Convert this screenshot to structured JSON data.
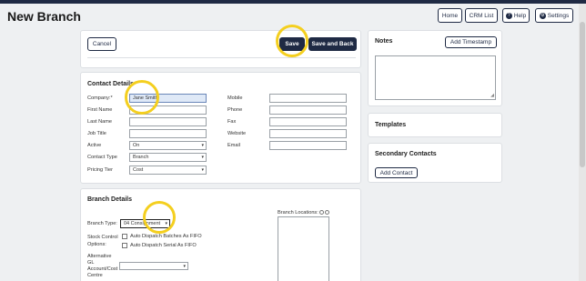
{
  "page": {
    "title": "New Branch"
  },
  "header": {
    "home": "Home",
    "crm_list": "CRM List",
    "help": "Help",
    "help_icon": "?",
    "settings": "Settings",
    "settings_icon": "⚙"
  },
  "actions": {
    "cancel": "Cancel",
    "save": "Save",
    "save_and_back": "Save and Back"
  },
  "contact_details": {
    "title": "Contact Details",
    "company_label": "Company:*",
    "company_value": "Jane Smith",
    "first_name_label": "First Name",
    "last_name_label": "Last Name",
    "job_title_label": "Job Title",
    "active_label": "Active",
    "active_value": "On",
    "contact_type_label": "Contact Type",
    "contact_type_value": "Branch",
    "pricing_tier_label": "Pricing Tier",
    "pricing_tier_value": "Cost",
    "mobile_label": "Mobile",
    "phone_label": "Phone",
    "fax_label": "Fax",
    "website_label": "Website",
    "email_label": "Email"
  },
  "branch_details": {
    "title": "Branch Details",
    "branch_type_label": "Branch Type:",
    "branch_type_value": "04 Consignment",
    "stock_control_label_1": "Stock Control",
    "stock_control_label_2": "Options:",
    "auto_dispatch_fifo": "Auto Dispatch Batches As FIFO",
    "auto_dispatch_serial": "Auto Dispatch Serial As FIFO",
    "alt_gl_label_1": "Alternative",
    "alt_gl_label_2": "GL",
    "alt_gl_label_3": "Account/Cost",
    "alt_gl_label_4": "Centre",
    "branch_locations_label": "Branch Locations:"
  },
  "notes": {
    "title": "Notes",
    "add_timestamp": "Add Timestamp"
  },
  "templates": {
    "title": "Templates"
  },
  "secondary_contacts": {
    "title": "Secondary Contacts",
    "add_contact": "Add Contact"
  },
  "colors": {
    "brand": "#1f2a44",
    "highlight_ring": "#f4cf1f",
    "field_highlight": "#dfe9f7"
  }
}
